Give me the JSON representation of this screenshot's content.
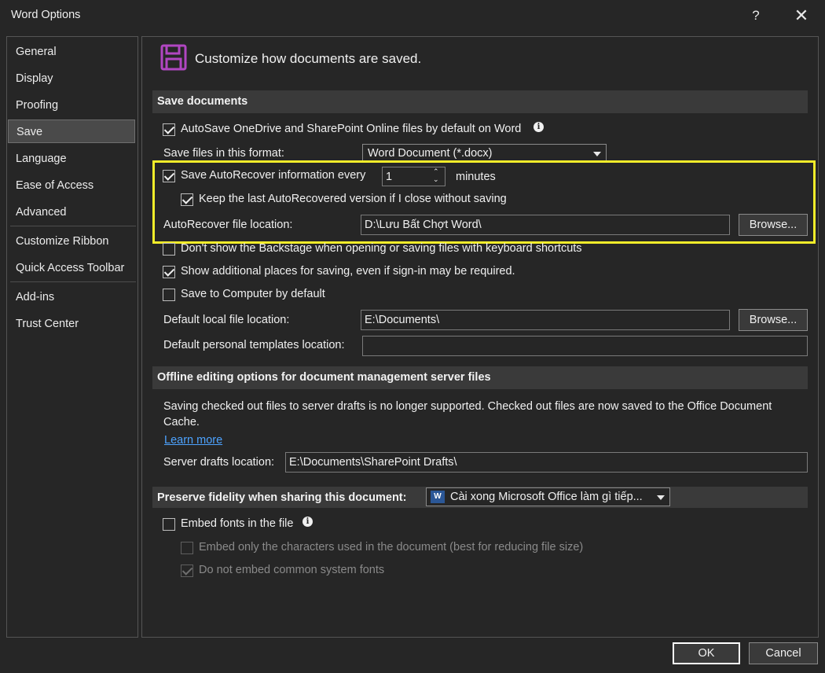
{
  "window": {
    "title": "Word Options",
    "help": "?",
    "close": "✕"
  },
  "nav": {
    "items": [
      "General",
      "Display",
      "Proofing",
      "Save",
      "Language",
      "Ease of Access",
      "Advanced",
      "Customize Ribbon",
      "Quick Access Toolbar",
      "Add-ins",
      "Trust Center"
    ],
    "selected": "Save"
  },
  "header": {
    "text": "Customize how documents are saved.",
    "icon": "save-floppy-icon",
    "icon_color": "#b146c2"
  },
  "save_documents": {
    "title": "Save documents",
    "autosave_label": "AutoSave OneDrive and SharePoint Online files by default on Word",
    "autosave_checked": true,
    "format_label": "Save files in this format:",
    "format_value": "Word Document (*.docx)",
    "autorecover_label": "Save AutoRecover information every",
    "autorecover_checked": true,
    "autorecover_minutes": "1",
    "minutes_label": "minutes",
    "keep_last_label": "Keep the last AutoRecovered version if I close without saving",
    "keep_last_checked": true,
    "ar_location_label": "AutoRecover file location:",
    "ar_location_value": "D:\\Lưu Bất Chợt Word\\",
    "browse_label": "Browse...",
    "backstage_label": "Don't show the Backstage when opening or saving files with keyboard shortcuts",
    "backstage_checked": false,
    "additional_places_label": "Show additional places for saving, even if sign-in may be required.",
    "additional_places_checked": true,
    "save_computer_label": "Save to Computer by default",
    "save_computer_checked": false,
    "default_local_label": "Default local file location:",
    "default_local_value": "E:\\Documents\\",
    "browse2_label": "Browse...",
    "templates_label": "Default personal templates location:",
    "templates_value": ""
  },
  "offline": {
    "title": "Offline editing options for document management server files",
    "description": "Saving checked out files to server drafts is no longer supported. Checked out files are now saved to the Office Document Cache.",
    "learn_more": "Learn more",
    "server_drafts_label": "Server drafts location:",
    "server_drafts_value": "E:\\Documents\\SharePoint Drafts\\"
  },
  "fidelity": {
    "title": "Preserve fidelity when sharing this document:",
    "document_value": "Cài xong Microsoft Office làm gì tiếp...",
    "embed_fonts_label": "Embed fonts in the file",
    "embed_fonts_checked": false,
    "embed_chars_label": "Embed only the characters used in the document (best for reducing file size)",
    "embed_chars_checked": false,
    "no_common_label": "Do not embed common system fonts",
    "no_common_checked": true
  },
  "footer": {
    "ok": "OK",
    "cancel": "Cancel"
  },
  "colors": {
    "highlight": "#f2ec2a",
    "link": "#4da3ff",
    "background": "#262626"
  }
}
